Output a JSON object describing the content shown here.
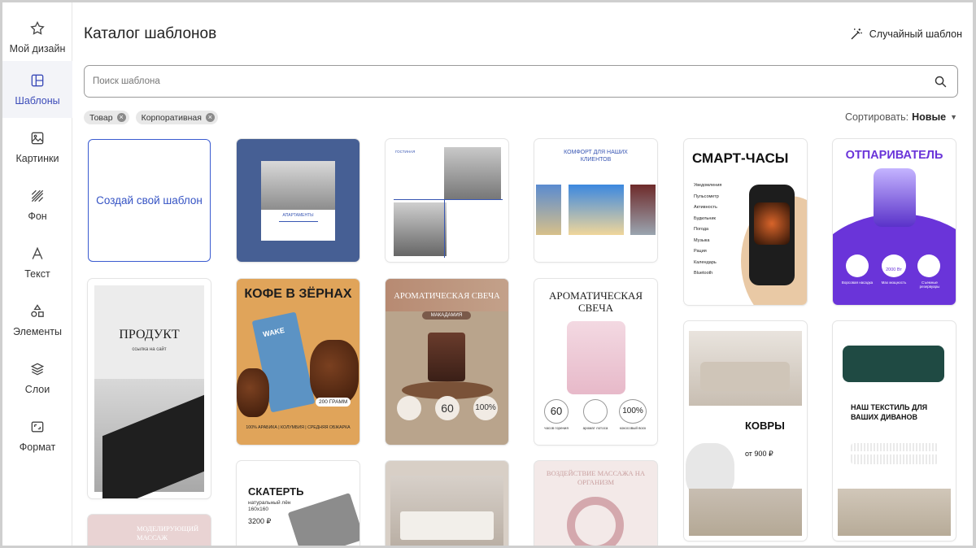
{
  "sidebar": {
    "items": [
      {
        "label": "Мой дизайн",
        "icon": "star-icon"
      },
      {
        "label": "Шаблоны",
        "icon": "template-icon",
        "active": true
      },
      {
        "label": "Картинки",
        "icon": "image-icon"
      },
      {
        "label": "Фон",
        "icon": "background-icon"
      },
      {
        "label": "Текст",
        "icon": "text-icon"
      },
      {
        "label": "Элементы",
        "icon": "shapes-icon"
      },
      {
        "label": "Слои",
        "icon": "layers-icon"
      },
      {
        "label": "Формат",
        "icon": "format-icon"
      }
    ]
  },
  "header": {
    "title": "Каталог шаблонов",
    "random_label": "Случайный шаблон"
  },
  "search": {
    "placeholder": "Поиск шаблона"
  },
  "filters": [
    "Товар",
    "Корпоративная"
  ],
  "sort": {
    "label": "Сортировать:",
    "value": "Новые"
  },
  "create_card": {
    "label": "Создай свой шаблон"
  },
  "templates": {
    "apartments": {
      "title": "АПАРТАМЕНТЫ"
    },
    "living": {
      "title": "ГОСТИНАЯ"
    },
    "comfort": {
      "title": "КОМФОРТ ДЛЯ НАШИХ КЛИЕНТОВ"
    },
    "smartwatch": {
      "title": "СМАРТ-ЧАСЫ",
      "features": [
        "Уведомления",
        "Пульсометр",
        "Активность",
        "Будильник",
        "Погода",
        "Музыка",
        "Рация",
        "Календарь",
        "Bluetooth"
      ]
    },
    "steamer": {
      "title": "ОТПАРИВАТЕЛЬ",
      "badge": "2000 Вт",
      "captions": [
        "Ворсовая насадка",
        "Max мощность",
        "Съемные резервуары"
      ]
    },
    "product": {
      "title": "ПРОДУКТ",
      "link": "ссылка на сайт"
    },
    "coffee": {
      "title": "КОФЕ В ЗЁРНАХ",
      "pack": "WAKE",
      "weight": "200 ГРАММ",
      "footer": "100% АРАБИКА | КОЛУМБИЯ | СРЕДНЯЯ ОБЖАРКА"
    },
    "candle1": {
      "title": "АРОМАТИЧЕСКАЯ СВЕЧА",
      "subtitle": "МАКАДАМИЯ",
      "stat1": "60",
      "stat2": "100%"
    },
    "candle2": {
      "title": "АРОМАТИЧЕСКАЯ СВЕЧА",
      "stat1": "60",
      "stat1_caption": "часов горения",
      "stat2_caption": "аромат лотоса",
      "stat3": "100%",
      "stat3_caption": "кокосовый воск"
    },
    "carpets": {
      "title": "КОВРЫ",
      "price": "от 900 ₽"
    },
    "textile": {
      "title": "НАШ ТЕКСТИЛЬ ДЛЯ ВАШИХ ДИВАНОВ"
    },
    "massage1": {
      "title": "МОДЕЛИРУЮЩИЙ МАССАЖ"
    },
    "tablecloth": {
      "title": "СКАТЕРТЬ",
      "desc": "натуральный лён",
      "size": "160x160",
      "price": "3200 ₽"
    },
    "massage2": {
      "title": "ВОЗДЕЙСТВИЕ МАССАЖА НА ОРГАНИЗМ"
    }
  },
  "colors": {
    "accent": "#3553c4",
    "active_bg": "#f3f4f8",
    "steamer_purple": "#6a34d9"
  }
}
